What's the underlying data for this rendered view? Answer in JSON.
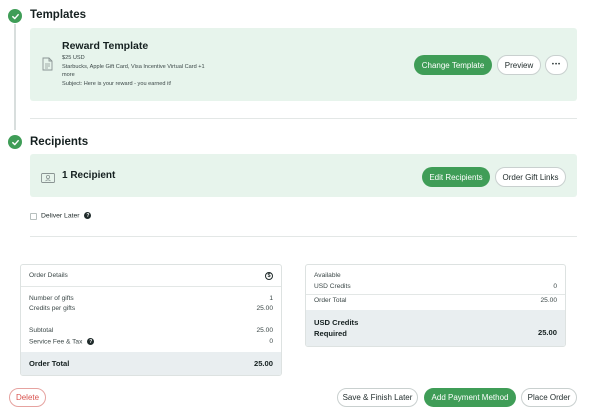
{
  "templates": {
    "title": "Templates",
    "template_name": "Reward Template",
    "amount": "$25 USD",
    "brands_line1": "Starbucks, Apple Gift Card, Visa Incentive Virtual Card +1",
    "brands_line2": "more",
    "subject": "Subject: Here is your reward - you earned it!",
    "change_label": "Change Template",
    "preview_label": "Preview",
    "more_label": "•••"
  },
  "recipients": {
    "title": "Recipients",
    "count_label": "1 Recipient",
    "edit_label": "Edit Recipients",
    "links_label": "Order Gift Links",
    "deliver_later_label": "Deliver Later",
    "help_glyph": "?"
  },
  "order_details": {
    "header": "Order Details",
    "currency_glyph": "$",
    "rows": [
      {
        "label": "Number of gifts",
        "value": "1"
      },
      {
        "label": "Credits per gifts",
        "value": "25.00"
      },
      {
        "label": "Subtotal",
        "value": "25.00"
      },
      {
        "label": "Service Fee & Tax",
        "value": "0"
      }
    ],
    "total_label": "Order Total",
    "total_value": "25.00"
  },
  "available": {
    "header": "Available",
    "usd_credits_label": "USD Credits",
    "usd_credits_value": "0",
    "order_total_label": "Order Total",
    "order_total_value": "25.00",
    "required_line1": "USD Credits",
    "required_line2": "Required",
    "required_value": "25.00"
  },
  "footer": {
    "delete_label": "Delete",
    "save_label": "Save & Finish Later",
    "add_payment_label": "Add Payment Method",
    "place_order_label": "Place Order"
  },
  "colors": {
    "accent": "#3f9d57",
    "panel": "#e7f4ec",
    "danger": "#d9534f"
  }
}
